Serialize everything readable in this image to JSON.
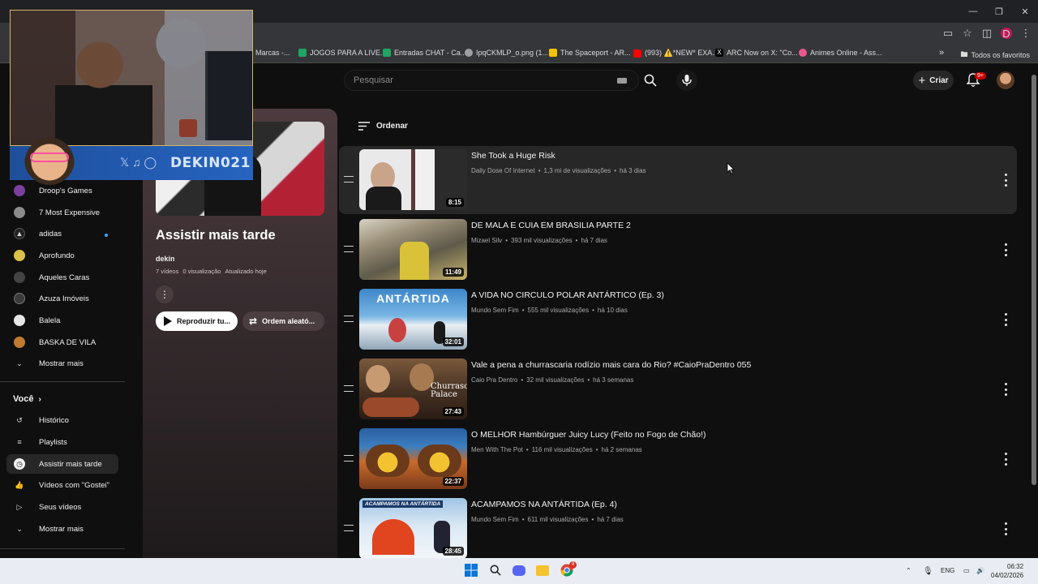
{
  "bookmarks": [
    {
      "label": "Marcas -...",
      "color": "#6d6d6d"
    },
    {
      "label": "JOGOS PARA A LIVE...",
      "color": "#1fa463"
    },
    {
      "label": "Entradas CHAT - Ca...",
      "color": "#1fa463"
    },
    {
      "label": "IpqCKMLP_o.png (1...",
      "color": "#9e9e9e"
    },
    {
      "label": "The Spaceport - AR...",
      "color": "#f2c200"
    },
    {
      "label": "(993) ⚠️*NEW* EXA...",
      "color": "#ff0000"
    },
    {
      "label": "ARC Now on X: \"Co...",
      "color": "#000000"
    },
    {
      "label": "Animes Online - Ass...",
      "color": "#e85a8a"
    }
  ],
  "bookmarks_all": "Todos os favoritos",
  "profile_initial": "D",
  "search": {
    "placeholder": "Pesquisar"
  },
  "header": {
    "create_label": "Criar",
    "notif_badge": "9+"
  },
  "webcam": {
    "handle": "DEKIN021"
  },
  "sidebar": {
    "subscriptions": [
      {
        "label": "Droop's Games",
        "color": "#7b3fa0"
      },
      {
        "label": "7 Most Expensive",
        "color": "#8a8a8a"
      },
      {
        "label": "adidas",
        "color": "#222222"
      },
      {
        "label": "Aprofundo",
        "color": "#d8c24a"
      },
      {
        "label": "Aqueles Caras",
        "color": "#444444"
      },
      {
        "label": "Azuza Imóveis",
        "color": "#3a3a3a"
      },
      {
        "label": "Balela",
        "color": "#e6e6e6"
      },
      {
        "label": "BASKA DE VILA",
        "color": "#c07a30"
      }
    ],
    "show_more_1": "Mostrar mais",
    "you_section": "Você",
    "you_items": [
      {
        "label": "Histórico",
        "icon": "history-icon"
      },
      {
        "label": "Playlists",
        "icon": "playlists-icon"
      },
      {
        "label": "Assistir mais tarde",
        "icon": "watch-later-icon"
      },
      {
        "label": "Vídeos com \"Gostei\"",
        "icon": "like-icon"
      },
      {
        "label": "Seus vídeos",
        "icon": "your-videos-icon"
      }
    ],
    "show_more_2": "Mostrar mais"
  },
  "playlist": {
    "title": "Assistir mais tarde",
    "owner": "dekin",
    "count": "7 vídeos",
    "views": "0 visualização",
    "updated": "Atualizado hoje",
    "play_all": "Reproduzir tu...",
    "shuffle": "Ordem aleató..."
  },
  "sort_label": "Ordenar",
  "videos": [
    {
      "title": "She Took a Huge Risk",
      "channel": "Daily Dose Of Internet",
      "views": "1,3 mi de visualizações",
      "age": "há 3 dias",
      "duration": "8:15"
    },
    {
      "title": "DE MALA E CUIA EM BRASILIA PARTE 2",
      "channel": "Mizael Silv",
      "views": "393 mil visualizações",
      "age": "há 7 dias",
      "duration": "11:49"
    },
    {
      "title": "A VIDA NO CIRCULO POLAR ANTÁRTICO (Ep. 3)",
      "channel": "Mundo Sem Fim",
      "views": "555 mil visualizações",
      "age": "há 10 dias",
      "duration": "32:01"
    },
    {
      "title": "Vale a pena a churrascaria rodízio mais cara do Rio? #CaioPraDentro 055",
      "channel": "Caio Pra Dentro",
      "views": "32 mil visualizações",
      "age": "há 3 semanas",
      "duration": "27:43"
    },
    {
      "title": "O MELHOR Hambúrguer Juicy Lucy (Feito no Fogo de Chão!)",
      "channel": "Men With The Pot",
      "views": "116 mil visualizações",
      "age": "há 2 semanas",
      "duration": "22:37"
    },
    {
      "title": "ACAMPAMOS NA ANTÁRTIDA (Ep. 4)",
      "channel": "Mundo Sem Fim",
      "views": "611 mil visualizações",
      "age": "há 7 dias",
      "duration": "28:45"
    }
  ],
  "thumb_texts": {
    "antartida": "ANTÁRTIDA",
    "churrascaria": "Churrascaria Palace",
    "acampamos": "ACAMPAMOS NA ANTÁRTIDA"
  },
  "taskbar": {
    "lang": "ENG",
    "time": "06:32",
    "date": "04/02/2026",
    "chrome_badge": "9"
  }
}
